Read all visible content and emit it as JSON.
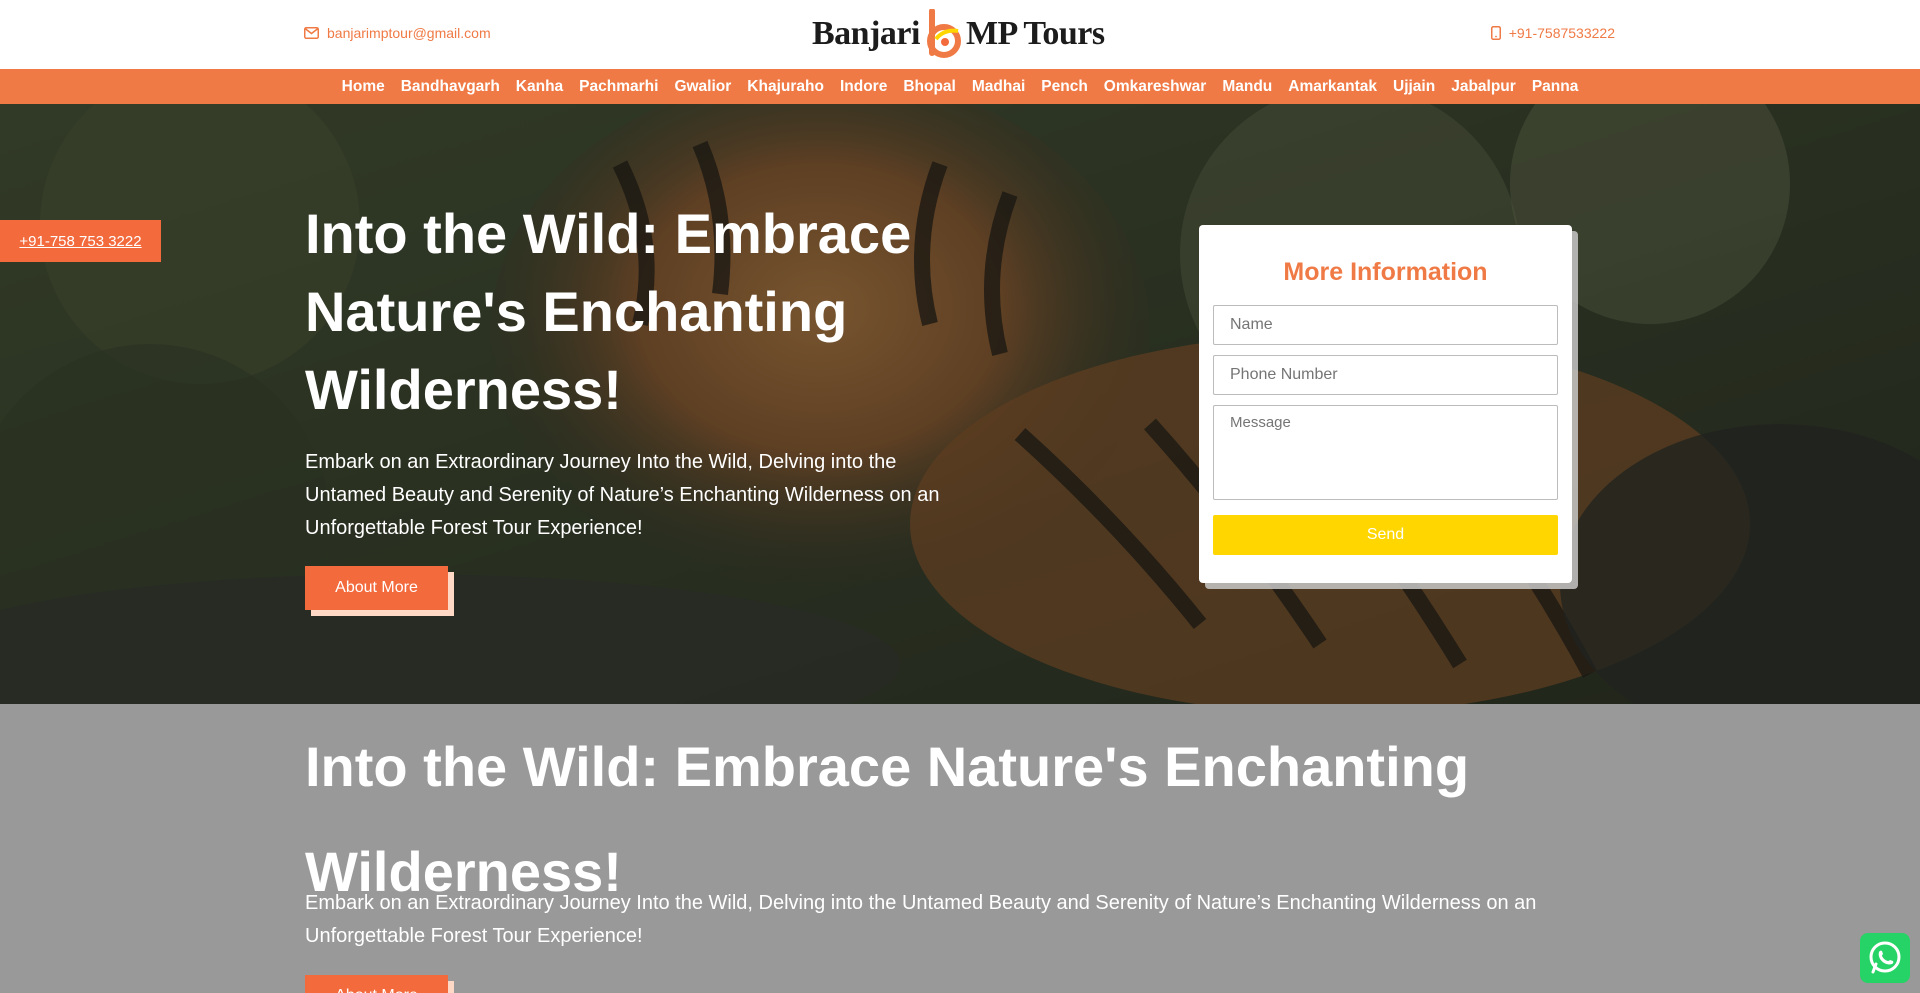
{
  "topbar": {
    "email": "banjarimptour@gmail.com",
    "phone": "+91-7587533222",
    "logo_left": "Banjari",
    "logo_right": "MP Tours"
  },
  "nav": {
    "items": [
      "Home",
      "Bandhavgarh",
      "Kanha",
      "Pachmarhi",
      "Gwalior",
      "Khajuraho",
      "Indore",
      "Bhopal",
      "Madhai",
      "Pench",
      "Omkareshwar",
      "Mandu",
      "Amarkantak",
      "Ujjain",
      "Jabalpur",
      "Panna"
    ]
  },
  "side_phone": "+91-758 753 3222",
  "hero": {
    "title": "Into the Wild: Embrace Nature's Enchanting Wilderness!",
    "text": "Embark on an Extraordinary Journey Into the Wild, Delving into the Untamed Beauty and Serenity of Nature’s Enchanting Wilderness on an Unforgettable Forest Tour Experience!",
    "button": "About More"
  },
  "form": {
    "title": "More Information",
    "name_placeholder": "Name",
    "phone_placeholder": "Phone Number",
    "message_placeholder": "Message",
    "submit": "Send"
  },
  "section2": {
    "title": "Into the Wild: Embrace Nature's Enchanting Wilderness!",
    "text": "Embark on an Extraordinary Journey Into the Wild, Delving into the Untamed Beauty and Serenity of Nature’s Enchanting Wilderness on an Unforgettable Forest Tour Experience!",
    "button": "About More"
  },
  "colors": {
    "accent": "#f07a45",
    "button": "#f36a3d",
    "send": "#ffd600",
    "whatsapp": "#25d366"
  },
  "icons": [
    "envelope-icon",
    "mobile-phone-icon",
    "whatsapp-icon"
  ]
}
